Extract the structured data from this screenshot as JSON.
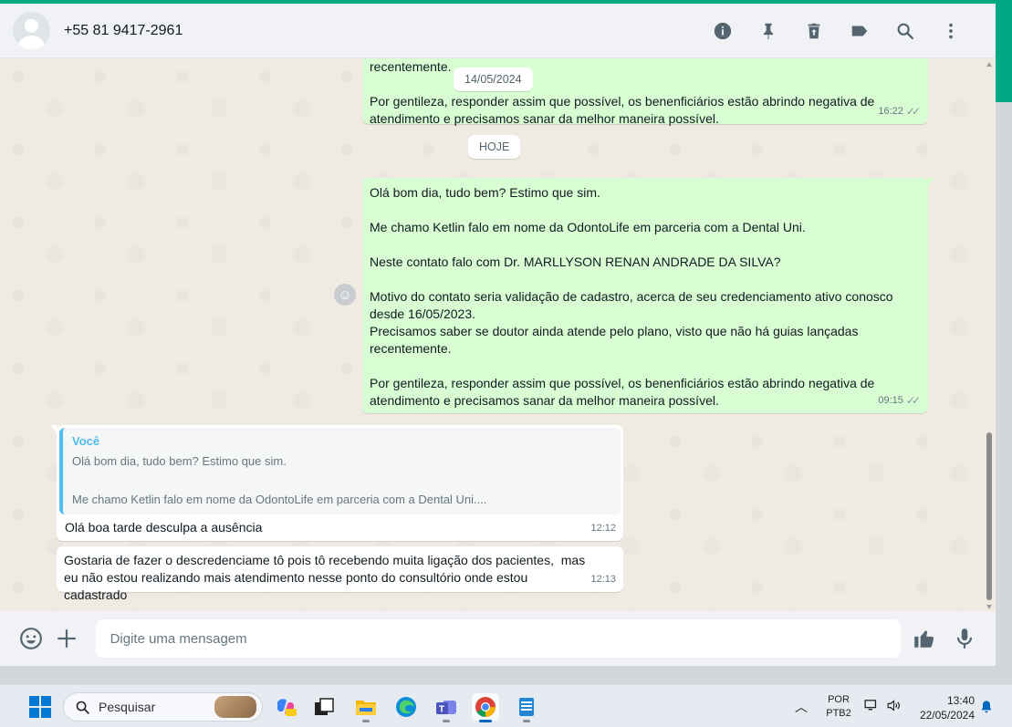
{
  "header": {
    "contact_name": "+55 81 9417-2961",
    "icons": [
      "info-icon",
      "pin-icon",
      "delete-icon",
      "label-icon",
      "search-icon",
      "menu-icon"
    ]
  },
  "chat": {
    "date_chip_1": "14/05/2024",
    "date_chip_2": "HOJE",
    "message_1": {
      "text_top": "recentemente.",
      "text": "Por gentileza, responder assim que possível, os benenficiários estão abrindo negativa de atendimento e precisamos sanar da melhor maneira possível.",
      "time": "16:22"
    },
    "message_2": {
      "text": "Olá bom dia, tudo bem? Estimo que sim.\n\nMe chamo Ketlin falo em nome da OdontoLife em parceria com a Dental Uni.\n\nNeste contato falo com Dr. MARLLYSON RENAN ANDRADE DA SILVA?\n\nMotivo do contato seria validação de cadastro, acerca de seu credenciamento ativo conosco desde 16/05/2023.\nPrecisamos saber se doutor ainda atende pelo plano, visto que não há guias lançadas recentemente.\n\nPor gentileza, responder assim que possível, os benenficiários estão abrindo negativa de atendimento e precisamos sanar da melhor maneira possível.",
      "time": "09:15"
    },
    "message_3": {
      "quote_author": "Você",
      "quote_text": "Olá bom dia, tudo bem? Estimo que sim.\n\nMe chamo Ketlin falo em nome da OdontoLife em parceria com a Dental Uni....",
      "text": "Olá boa tarde desculpa a ausência",
      "time": "12:12"
    },
    "message_4": {
      "text": "Gostaria de fazer o descredenciame tô pois tô recebendo muita ligação dos pacientes,  mas eu não estou realizando mais atendimento nesse ponto do consultório onde estou cadastrado",
      "time": "12:13"
    }
  },
  "composer": {
    "placeholder": "Digite uma mensagem"
  },
  "taskbar": {
    "search_label": "Pesquisar",
    "lang_line1": "POR",
    "lang_line2": "PTB2",
    "time": "13:40",
    "date": "22/05/2024"
  },
  "colors": {
    "accent": "#00a884",
    "outgoing_bubble": "#d9fdd3",
    "incoming_bubble": "#ffffff",
    "quote_bar": "#53bdeb"
  }
}
